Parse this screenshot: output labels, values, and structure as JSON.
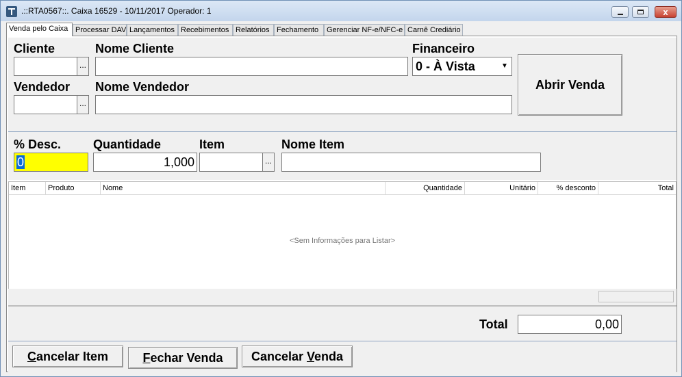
{
  "window": {
    "title": ".::RTA0567::. Caixa 16529 - 10/11/2017 Operador: 1",
    "close_glyph": "x"
  },
  "tabs": [
    {
      "label": "Venda pelo Caixa",
      "active": true
    },
    {
      "label": "Processar DAV"
    },
    {
      "label": "Lançamentos"
    },
    {
      "label": "Recebimentos"
    },
    {
      "label": "Relatórios"
    },
    {
      "label": "Fechamento"
    },
    {
      "label": "Gerenciar NF-e/NFC-e"
    },
    {
      "label": "Carnê Crediário"
    }
  ],
  "cliente": {
    "label": "Cliente",
    "value": "",
    "lookup": "...",
    "nome_label": "Nome Cliente",
    "nome_value": ""
  },
  "financeiro": {
    "label": "Financeiro",
    "selected": "0 - À Vista",
    "arrow": "▼"
  },
  "vendedor": {
    "label": "Vendedor",
    "value": "",
    "lookup": "...",
    "nome_label": "Nome Vendedor",
    "nome_value": ""
  },
  "abrir_venda": "Abrir Venda",
  "item_entry": {
    "desc_label": "% Desc.",
    "desc_value": "0",
    "quantidade_label": "Quantidade",
    "quantidade_value": "1,000",
    "item_label": "Item",
    "item_value": "",
    "item_lookup": "...",
    "nome_item_label": "Nome Item",
    "nome_item_value": ""
  },
  "grid": {
    "columns": [
      "Item",
      "Produto",
      "Nome",
      "Quantidade",
      "Unitário",
      "% desconto",
      "Total"
    ],
    "empty_message": "<Sem Informações para Listar>"
  },
  "total": {
    "label": "Total",
    "value": "0,00"
  },
  "buttons": {
    "cancelar_item_prefix": "C",
    "cancelar_item_rest": "ancelar Item",
    "fechar_venda_prefix": "F",
    "fechar_venda_rest": "echar Venda",
    "cancelar_venda_first": "Cancelar ",
    "cancelar_venda_u": "V",
    "cancelar_venda_rest": "enda"
  }
}
